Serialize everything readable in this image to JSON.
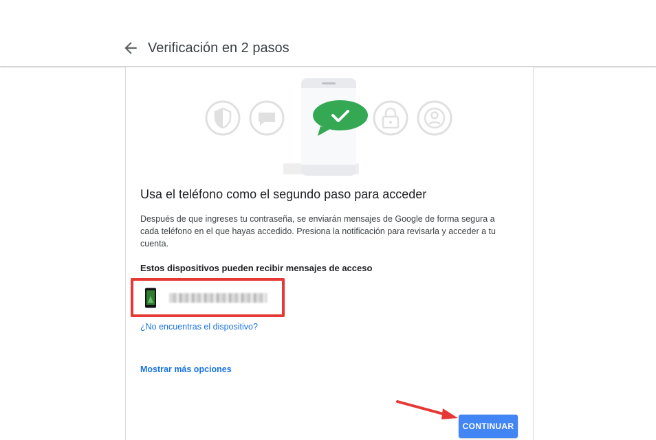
{
  "header": {
    "title": "Verificación en 2 pasos",
    "back_icon": "arrow-back-icon"
  },
  "illustration": {
    "icons": [
      "shield-icon",
      "chat-bubble-icon",
      "phone-check-bubble-icon",
      "lock-icon",
      "account-circle-icon"
    ],
    "accent_color": "#34a853"
  },
  "main": {
    "headline": "Usa el teléfono como el segundo paso para acceder",
    "description": "Después de que ingreses tu contraseña, se enviarán mensajes de Google de forma segura a cada teléfono en el que hayas accedido. Presiona la notificación para revisarla y acceder a tu cuenta.",
    "devices_title": "Estos dispositivos pueden recibir mensajes de acceso",
    "device_icon": "smartphone-icon",
    "missing_device_link": "¿No encuentras el dispositivo?",
    "more_options_link": "Mostrar más opciones",
    "continue_label": "CONTINUAR"
  },
  "colors": {
    "link": "#1a73e8",
    "button": "#4285f4",
    "highlight": "#e53935"
  }
}
